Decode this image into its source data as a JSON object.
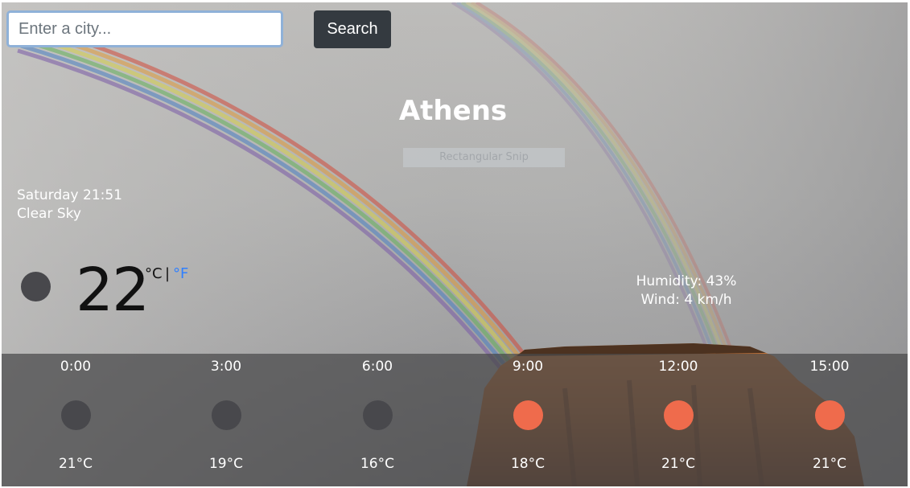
{
  "search": {
    "placeholder": "Enter a city...",
    "value": "",
    "button_label": "Search"
  },
  "snip_overlay": "Rectangular Snip",
  "current": {
    "city": "Athens",
    "datetime": "Saturday 21:51",
    "description": "Clear Sky",
    "icon": "moon-icon",
    "icon_color": "#48484c",
    "temperature": "22",
    "unit_celsius": "°C",
    "unit_separator": "|",
    "unit_fahrenheit": "°F",
    "humidity": "Humidity: 43%",
    "wind": "Wind: 4 km/h"
  },
  "colors": {
    "accent_link": "#2f80ff",
    "button_bg": "#343a40",
    "night_icon": "#48484c",
    "day_icon": "#ef6b4c"
  },
  "forecast": [
    {
      "time": "0:00",
      "temp": "21°C",
      "icon": "moon-icon",
      "color": "#48484c"
    },
    {
      "time": "3:00",
      "temp": "19°C",
      "icon": "moon-icon",
      "color": "#48484c"
    },
    {
      "time": "6:00",
      "temp": "16°C",
      "icon": "moon-icon",
      "color": "#48484c"
    },
    {
      "time": "9:00",
      "temp": "18°C",
      "icon": "sun-icon",
      "color": "#ef6b4c"
    },
    {
      "time": "12:00",
      "temp": "21°C",
      "icon": "sun-icon",
      "color": "#ef6b4c"
    },
    {
      "time": "15:00",
      "temp": "21°C",
      "icon": "sun-icon",
      "color": "#ef6b4c"
    }
  ]
}
